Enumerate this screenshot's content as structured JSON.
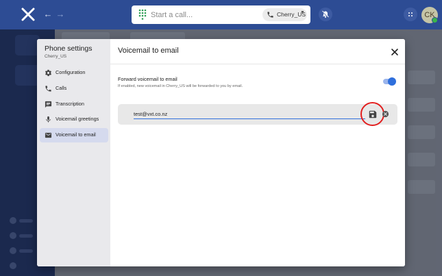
{
  "topbar": {
    "call_placeholder": "Start a call...",
    "line_label": "Cherry_US",
    "avatar_initials": "CK"
  },
  "modal": {
    "sidebar": {
      "title": "Phone settings",
      "subtitle": "Cherry_US",
      "items": [
        {
          "label": "Configuration",
          "icon": "gear-icon"
        },
        {
          "label": "Calls",
          "icon": "phone-icon"
        },
        {
          "label": "Transcription",
          "icon": "transcript-icon"
        },
        {
          "label": "Voicemail greetings",
          "icon": "microphone-icon"
        },
        {
          "label": "Voicemail to email",
          "icon": "mail-icon",
          "active": true
        }
      ]
    },
    "main": {
      "title": "Voicemail to email",
      "forward_title": "Forward voicemail to email",
      "forward_desc": "If enabled, new voicemail in Cherry_US will be forwarded to you by email.",
      "forward_enabled": true,
      "email_value": "test@vxt.co.nz"
    }
  },
  "colors": {
    "topbar": "#2d4c94",
    "accent": "#2f6fdc",
    "highlight": "#e21e1e",
    "sidebar_active": "#d5daee"
  }
}
